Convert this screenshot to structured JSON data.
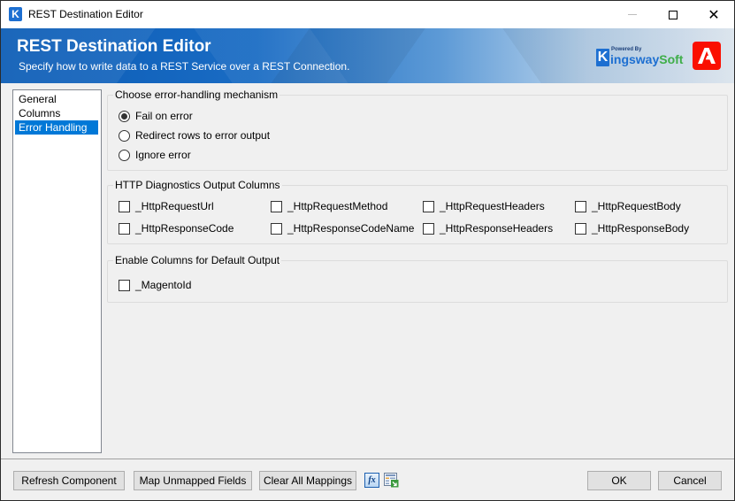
{
  "window": {
    "title": "REST Destination Editor",
    "app_icon_letter": "K",
    "controls": {
      "minimize": "minimize",
      "maximize": "maximize",
      "close": "✕"
    }
  },
  "banner": {
    "title": "REST Destination Editor",
    "subtitle": "Specify how to write data to a REST Service over a REST Connection.",
    "vendor_logo": {
      "letter": "K",
      "powered_by": "Powered By",
      "name_part1": "ingsway",
      "name_part2": "Soft"
    },
    "brand_colors": {
      "kingsway_blue": "#1d6fd1",
      "kingsway_green": "#3fae49",
      "adobe_red": "#fa0f00"
    }
  },
  "sidebar": {
    "items": [
      {
        "label": "General",
        "selected": false
      },
      {
        "label": "Columns",
        "selected": false
      },
      {
        "label": "Error Handling",
        "selected": true
      }
    ]
  },
  "error_handling": {
    "label": "Choose error-handling mechanism",
    "options": [
      {
        "label": "Fail on error",
        "checked": true
      },
      {
        "label": "Redirect rows to error output",
        "checked": false
      },
      {
        "label": "Ignore error",
        "checked": false
      }
    ]
  },
  "http_diagnostics": {
    "label": "HTTP Diagnostics Output Columns",
    "columns": [
      {
        "label": "_HttpRequestUrl",
        "checked": false
      },
      {
        "label": "_HttpRequestMethod",
        "checked": false
      },
      {
        "label": "_HttpRequestHeaders",
        "checked": false
      },
      {
        "label": "_HttpRequestBody",
        "checked": false
      },
      {
        "label": "_HttpResponseCode",
        "checked": false
      },
      {
        "label": "_HttpResponseCodeName",
        "checked": false
      },
      {
        "label": "_HttpResponseHeaders",
        "checked": false
      },
      {
        "label": "_HttpResponseBody",
        "checked": false
      }
    ]
  },
  "default_output": {
    "label": "Enable Columns for Default Output",
    "columns": [
      {
        "label": "_MagentoId",
        "checked": false
      }
    ]
  },
  "footer": {
    "refresh_label": "Refresh Component",
    "map_unmapped_label": "Map Unmapped Fields",
    "clear_mappings_label": "Clear All Mappings",
    "fx_icon_text": "fx",
    "ok_label": "OK",
    "cancel_label": "Cancel"
  }
}
